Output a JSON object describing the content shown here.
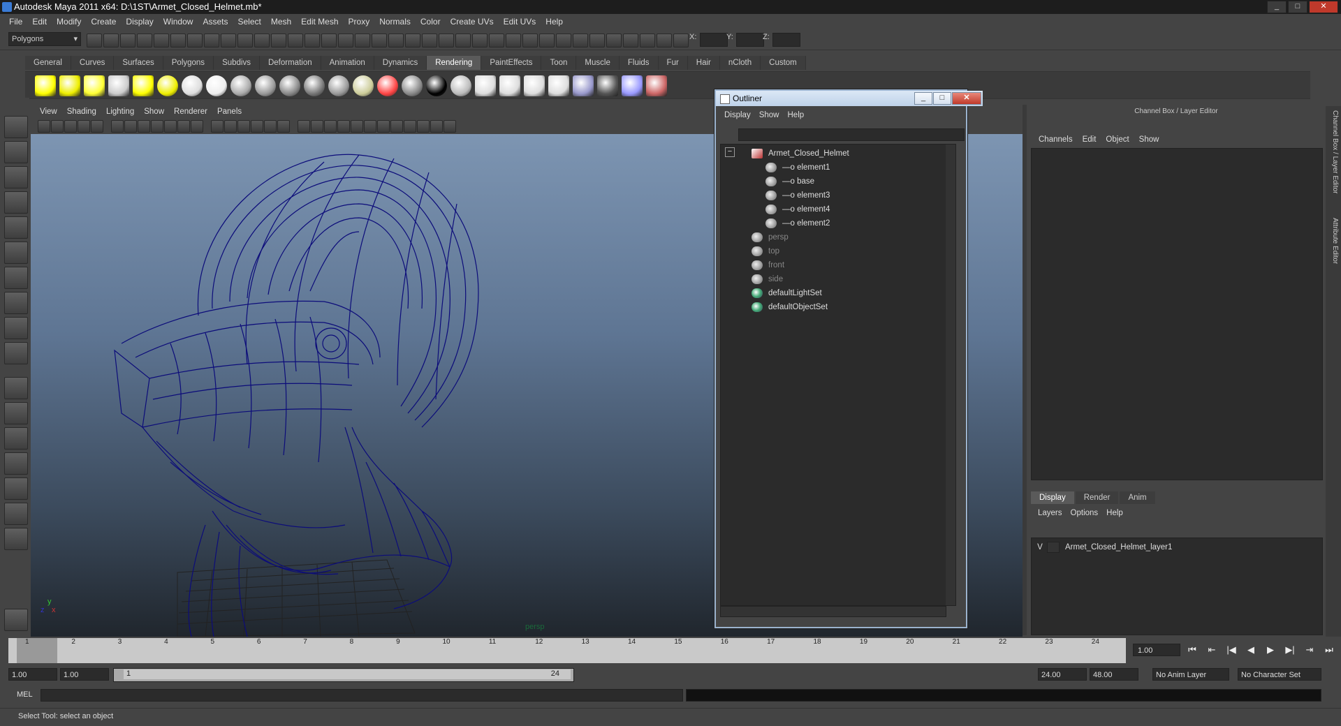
{
  "window": {
    "title": "Autodesk Maya 2011 x64: D:\\1ST\\Armet_Closed_Helmet.mb*"
  },
  "menubar": [
    "File",
    "Edit",
    "Modify",
    "Create",
    "Display",
    "Window",
    "Assets",
    "Select",
    "Mesh",
    "Edit Mesh",
    "Proxy",
    "Normals",
    "Color",
    "Create UVs",
    "Edit UVs",
    "Help"
  ],
  "statusline": {
    "mode": "Polygons",
    "x_label": "X:",
    "y_label": "Y:",
    "z_label": "Z:"
  },
  "shelf": {
    "tabs": [
      "General",
      "Curves",
      "Surfaces",
      "Polygons",
      "Subdivs",
      "Deformation",
      "Animation",
      "Dynamics",
      "Rendering",
      "PaintEffects",
      "Toon",
      "Muscle",
      "Fluids",
      "Fur",
      "Hair",
      "nCloth",
      "Custom"
    ],
    "active": "Rendering"
  },
  "panel": {
    "menu": [
      "View",
      "Shading",
      "Lighting",
      "Show",
      "Renderer",
      "Panels"
    ],
    "camera_label": "persp",
    "axis_y": "y",
    "axis_z": "z",
    "axis_x": "x"
  },
  "outliner": {
    "title": "Outliner",
    "menu": [
      "Display",
      "Show",
      "Help"
    ],
    "items": [
      {
        "label": "Armet_Closed_Helmet",
        "kind": "group",
        "depth": 0,
        "dim": false
      },
      {
        "label": "element1",
        "kind": "mesh",
        "depth": 1,
        "dim": false
      },
      {
        "label": "base",
        "kind": "mesh",
        "depth": 1,
        "dim": false
      },
      {
        "label": "element3",
        "kind": "mesh",
        "depth": 1,
        "dim": false
      },
      {
        "label": "element4",
        "kind": "mesh",
        "depth": 1,
        "dim": false
      },
      {
        "label": "element2",
        "kind": "mesh",
        "depth": 1,
        "dim": false
      },
      {
        "label": "persp",
        "kind": "camera",
        "depth": 0,
        "dim": true
      },
      {
        "label": "top",
        "kind": "camera",
        "depth": 0,
        "dim": true
      },
      {
        "label": "front",
        "kind": "camera",
        "depth": 0,
        "dim": true
      },
      {
        "label": "side",
        "kind": "camera",
        "depth": 0,
        "dim": true
      },
      {
        "label": "defaultLightSet",
        "kind": "set",
        "depth": 0,
        "dim": false
      },
      {
        "label": "defaultObjectSet",
        "kind": "set",
        "depth": 0,
        "dim": false
      }
    ]
  },
  "channelbox": {
    "header": "Channel Box / Layer Editor",
    "menu": [
      "Channels",
      "Edit",
      "Object",
      "Show"
    ],
    "side_tabs": [
      "Channel Box / Layer Editor",
      "Attribute Editor"
    ]
  },
  "layereditor": {
    "tabs": [
      "Display",
      "Render",
      "Anim"
    ],
    "active": "Display",
    "menu": [
      "Layers",
      "Options",
      "Help"
    ],
    "layers": [
      {
        "visible": "V",
        "name": "Armet_Closed_Helmet_layer1"
      }
    ]
  },
  "timeslider": {
    "ticks": [
      "1",
      "2",
      "3",
      "4",
      "5",
      "6",
      "7",
      "8",
      "9",
      "10",
      "11",
      "12",
      "13",
      "14",
      "15",
      "16",
      "17",
      "18",
      "19",
      "20",
      "21",
      "22",
      "23",
      "24"
    ],
    "current_frame": "1.00"
  },
  "range": {
    "start": "1.00",
    "playback_start": "1.00",
    "slider_start": "1",
    "slider_end": "24",
    "playback_end": "24.00",
    "end": "48.00",
    "anim_layer": "No Anim Layer",
    "character_set": "No Character Set"
  },
  "command": {
    "label": "MEL"
  },
  "helpline": {
    "text": "Select Tool: select an object"
  }
}
